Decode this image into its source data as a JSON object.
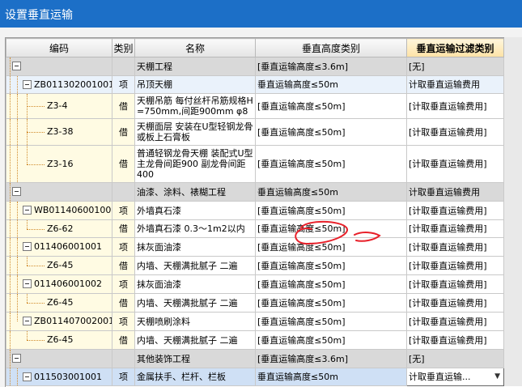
{
  "window": {
    "title": "设置垂直运输"
  },
  "columns": {
    "code": "编码",
    "type": "类别",
    "name": "名称",
    "height": "垂直高度类别",
    "filter": "垂直运输过滤类别"
  },
  "rows": [
    {
      "code": "",
      "type": "",
      "name": "天棚工程",
      "height": "[垂直运输高度≤3.6m]",
      "filter": "[无]"
    },
    {
      "code": "ZB011302001001",
      "type": "项",
      "name": "吊顶天棚",
      "height": "垂直运输高度≤50m",
      "filter": "计取垂直运输费用"
    },
    {
      "code": "Z3-4",
      "type": "借",
      "name": "天棚吊筋 每付丝杆吊筋规格H=750mm,间距900mm φ8",
      "height": "[垂直运输高度≤50m]",
      "filter": "[计取垂直运输费用]"
    },
    {
      "code": "Z3-38",
      "type": "借",
      "name": "天棚面层 安装在U型轻钢龙骨或板上石膏板",
      "height": "[垂直运输高度≤50m]",
      "filter": "[计取垂直运输费用]"
    },
    {
      "code": "Z3-16",
      "type": "借",
      "name": "普通轻钢龙骨天棚 装配式U型主龙骨间距900 副龙骨间距 400",
      "height": "[垂直运输高度≤50m]",
      "filter": "[计取垂直运输费用]"
    },
    {
      "code": "",
      "type": "",
      "name": "油漆、涂料、裱糊工程",
      "height": "垂直运输高度≤50m",
      "filter": "计取垂直运输费用"
    },
    {
      "code": "WB011406001001",
      "type": "项",
      "name": "外墙真石漆",
      "height": "[垂直运输高度≤50m]",
      "filter": "[计取垂直运输费用]"
    },
    {
      "code": "Z6-62",
      "type": "借",
      "name": "外墙真石漆 0.3～1m2以内",
      "height": "[垂直运输高度≤50m]",
      "filter": "[计取垂直运输费用]"
    },
    {
      "code": "011406001001",
      "type": "项",
      "name": "抹灰面油漆",
      "height": "[垂直运输高度≤50m]",
      "filter": "[计取垂直运输费用]"
    },
    {
      "code": "Z6-45",
      "type": "借",
      "name": "内墙、天棚满批腻子 二遍",
      "height": "[垂直运输高度≤50m]",
      "filter": "[计取垂直运输费用]"
    },
    {
      "code": "011406001002",
      "type": "项",
      "name": "抹灰面油漆",
      "height": "[垂直运输高度≤50m]",
      "filter": "[计取垂直运输费用]"
    },
    {
      "code": "Z6-45",
      "type": "借",
      "name": "内墙、天棚满批腻子 二遍",
      "height": "[垂直运输高度≤50m]",
      "filter": "[计取垂直运输费用]"
    },
    {
      "code": "ZB011407002001",
      "type": "项",
      "name": "天棚喷刷涂料",
      "height": "[垂直运输高度≤50m]",
      "filter": "[计取垂直运输费用]"
    },
    {
      "code": "Z6-45",
      "type": "借",
      "name": "内墙、天棚满批腻子 二遍",
      "height": "[垂直运输高度≤50m]",
      "filter": "[计取垂直运输费用]"
    },
    {
      "code": "",
      "type": "",
      "name": "其他装饰工程",
      "height": "[垂直运输高度≤3.6m]",
      "filter": "[无]"
    },
    {
      "code": "011503001001",
      "type": "项",
      "name": "金属扶手、栏杆、栏板",
      "height": "垂直运输高度≤50m",
      "filter": "计取垂直运输..."
    }
  ],
  "annotation_color": "#e8202a"
}
